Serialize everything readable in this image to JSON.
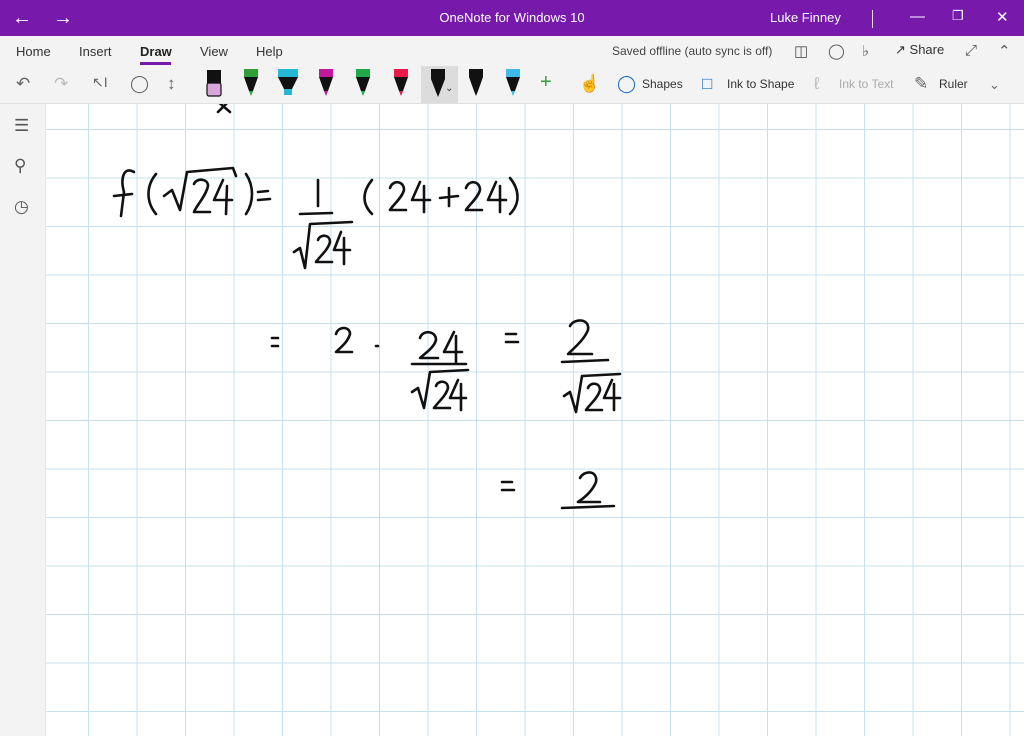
{
  "window": {
    "title": "OneNote for Windows 10",
    "user": "Luke Finney"
  },
  "menu": {
    "tabs": [
      "Home",
      "Insert",
      "Draw",
      "View",
      "Help"
    ],
    "active_tab": "Draw",
    "sync_status": "Saved offline (auto sync is off)",
    "share_label": "Share"
  },
  "toolbar": {
    "shapes_label": "Shapes",
    "ink_to_shape_label": "Ink to Shape",
    "ink_to_text_label": "Ink to Text",
    "ruler_label": "Ruler",
    "pens": [
      {
        "name": "eraser",
        "color": "#d9a6dc"
      },
      {
        "name": "pen-green",
        "color": "#2e9e3a"
      },
      {
        "name": "highlighter-cyan",
        "color": "#25b7d3"
      },
      {
        "name": "pen-magenta",
        "color": "#c2179b"
      },
      {
        "name": "pen-green-2",
        "color": "#1fa94a"
      },
      {
        "name": "pen-red",
        "color": "#e8194b"
      },
      {
        "name": "pen-black-selected",
        "color": "#111111"
      },
      {
        "name": "pen-black",
        "color": "#111111"
      },
      {
        "name": "pen-light-blue",
        "color": "#3fb8ea"
      }
    ]
  },
  "accent_color": "#7719aa"
}
